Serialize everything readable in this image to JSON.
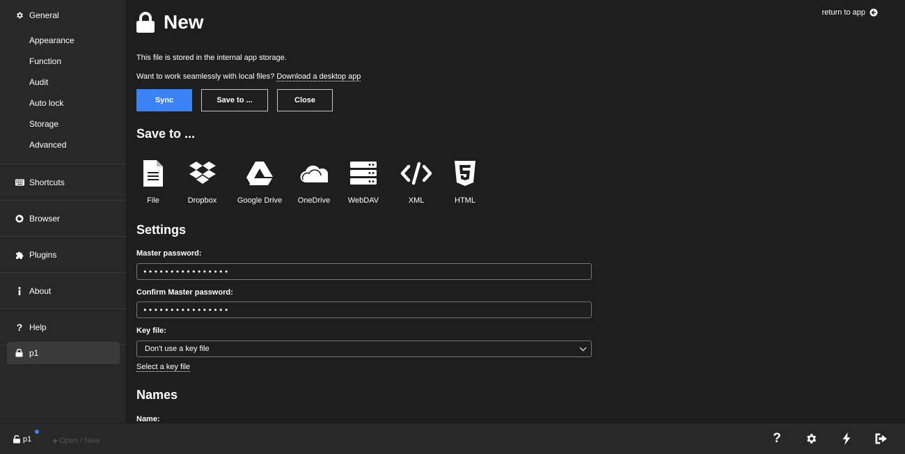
{
  "sidebar": {
    "general": "General",
    "general_items": [
      "Appearance",
      "Function",
      "Audit",
      "Auto lock",
      "Storage",
      "Advanced"
    ],
    "shortcuts": "Shortcuts",
    "browser": "Browser",
    "plugins": "Plugins",
    "about": "About",
    "help": "Help",
    "file": "p1"
  },
  "header": {
    "return_label": "return to app",
    "title": "New"
  },
  "info": {
    "storage_text": "This file is stored in the internal app storage.",
    "desktop_text": "Want to work seamlessly with local files?",
    "desktop_link": "Download a desktop app"
  },
  "buttons": {
    "sync": "Sync",
    "save_to": "Save to ...",
    "close": "Close"
  },
  "save_to": {
    "heading": "Save to ...",
    "options": [
      {
        "label": "File",
        "icon": "file-icon"
      },
      {
        "label": "Dropbox",
        "icon": "dropbox-icon"
      },
      {
        "label": "Google Drive",
        "icon": "google-drive-icon"
      },
      {
        "label": "OneDrive",
        "icon": "onedrive-icon"
      },
      {
        "label": "WebDAV",
        "icon": "webdav-icon"
      },
      {
        "label": "XML",
        "icon": "xml-icon"
      },
      {
        "label": "HTML",
        "icon": "html-icon"
      }
    ]
  },
  "settings": {
    "heading": "Settings",
    "master_password_label": "Master password:",
    "master_password_value": "••••••••••••••••",
    "confirm_password_label": "Confirm Master password:",
    "confirm_password_value": "••••••••••••••••",
    "key_file_label": "Key file:",
    "key_file_value": "Don't use a key file",
    "select_key_file": "Select a key file"
  },
  "names": {
    "heading": "Names",
    "name_label": "Name:"
  },
  "footer": {
    "file": "p1",
    "open_new": "Open / New"
  },
  "colors": {
    "accent": "#3b82f6",
    "background": "#1e1e1e",
    "sidebar": "#282828"
  }
}
